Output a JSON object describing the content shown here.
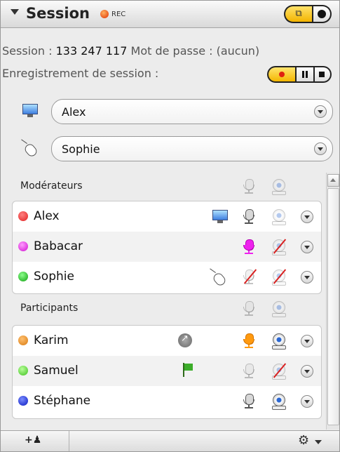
{
  "header": {
    "title": "Session",
    "rec_badge": "REC"
  },
  "session_line": {
    "label": "Session :",
    "id": "133 247 117",
    "password_label": "Mot de passe :",
    "password_value": "(aucun)"
  },
  "recording_line": {
    "label": "Enregistrement de session :"
  },
  "presenter_select": {
    "value": "Alex",
    "icon": "monitor-icon"
  },
  "controller_select": {
    "value": "Sophie",
    "icon": "mouse-icon"
  },
  "moderators": {
    "label": "Modérateurs",
    "rows": [
      {
        "name": "Alex",
        "status_color": "#e02020",
        "extra": "monitor-icon",
        "mic": "on",
        "cam": "dim"
      },
      {
        "name": "Babacar",
        "status_color": "#e020e0",
        "extra": "",
        "mic": "speaking-pink",
        "cam": "off"
      },
      {
        "name": "Sophie",
        "status_color": "#20b020",
        "extra": "mouse-icon",
        "mic": "off",
        "cam": "off"
      }
    ]
  },
  "participants": {
    "label": "Participants",
    "rows": [
      {
        "name": "Karim",
        "status_color": "#e08a20",
        "extra": "arrow-icon",
        "mic": "speaking-orange",
        "cam": "on"
      },
      {
        "name": "Samuel",
        "status_color": "#60d040",
        "extra": "flag-icon",
        "mic": "dim",
        "cam": "off"
      },
      {
        "name": "Stéphane",
        "status_color": "#1a2ad0",
        "extra": "",
        "mic": "on",
        "cam": "on"
      }
    ]
  },
  "footer": {
    "add_label": "+",
    "settings_icon": "gear-icon"
  }
}
